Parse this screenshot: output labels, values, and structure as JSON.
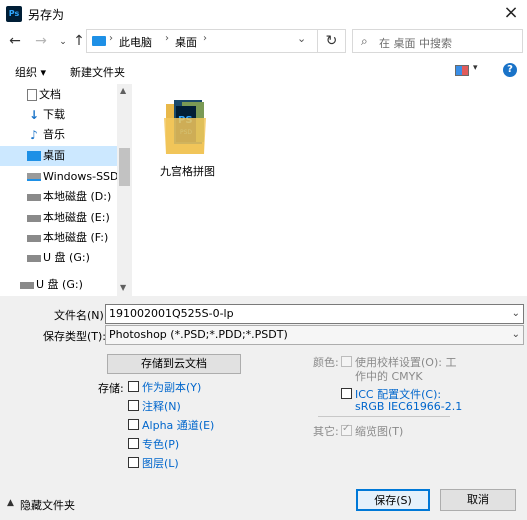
{
  "window": {
    "title": "另存为",
    "app_icon_text": "Ps"
  },
  "address": {
    "crumbs": [
      "此电脑",
      "桌面"
    ]
  },
  "search": {
    "placeholder": "在 桌面 中搜索"
  },
  "toolbar": {
    "organize": "组织 ▾",
    "new_folder": "新建文件夹"
  },
  "nav": {
    "items": [
      {
        "label": "文档",
        "icon": "document-icon"
      },
      {
        "label": "下载",
        "icon": "download-icon"
      },
      {
        "label": "音乐",
        "icon": "music-icon"
      },
      {
        "label": "桌面",
        "icon": "desktop-icon"
      },
      {
        "label": "Windows-SSD (",
        "icon": "drive-icon"
      },
      {
        "label": "本地磁盘 (D:)",
        "icon": "drive-icon"
      },
      {
        "label": "本地磁盘 (E:)",
        "icon": "drive-icon"
      },
      {
        "label": "本地磁盘 (F:)",
        "icon": "drive-icon"
      },
      {
        "label": "U 盘 (G:)",
        "icon": "usb-icon"
      },
      {
        "label": "U 盘 (G:)",
        "icon": "usb-icon"
      }
    ]
  },
  "files": [
    {
      "name": "九宫格拼图",
      "type": "psd-folder"
    }
  ],
  "form": {
    "filename_label": "文件名(N):",
    "filename_value": "191002001Q525S-0-lp",
    "filetype_label": "保存类型(T):",
    "filetype_value": "Photoshop (*.PSD;*.PDD;*.PSDT)",
    "cloud_button": "存储到云文档",
    "storage_label": "存储:",
    "storage_options": [
      {
        "label": "作为副本(Y)",
        "blue": true
      },
      {
        "label": "注释(N)",
        "blue": true
      },
      {
        "label": "Alpha 通道(E)",
        "blue": true
      },
      {
        "label": "专色(P)",
        "blue": true
      },
      {
        "label": "图层(L)",
        "blue": true
      }
    ],
    "color_label": "颜色:",
    "proof_label": "使用校样设置(O): 工",
    "proof_label2": "作中的 CMYK",
    "icc_label": "ICC 配置文件(C):",
    "icc_value": "sRGB IEC61966-2.1",
    "other_label": "其它:",
    "thumbnail_label": "缩览图(T)",
    "hide_folders": "隐藏文件夹",
    "save_button": "保存(S)",
    "cancel_button": "取消"
  }
}
